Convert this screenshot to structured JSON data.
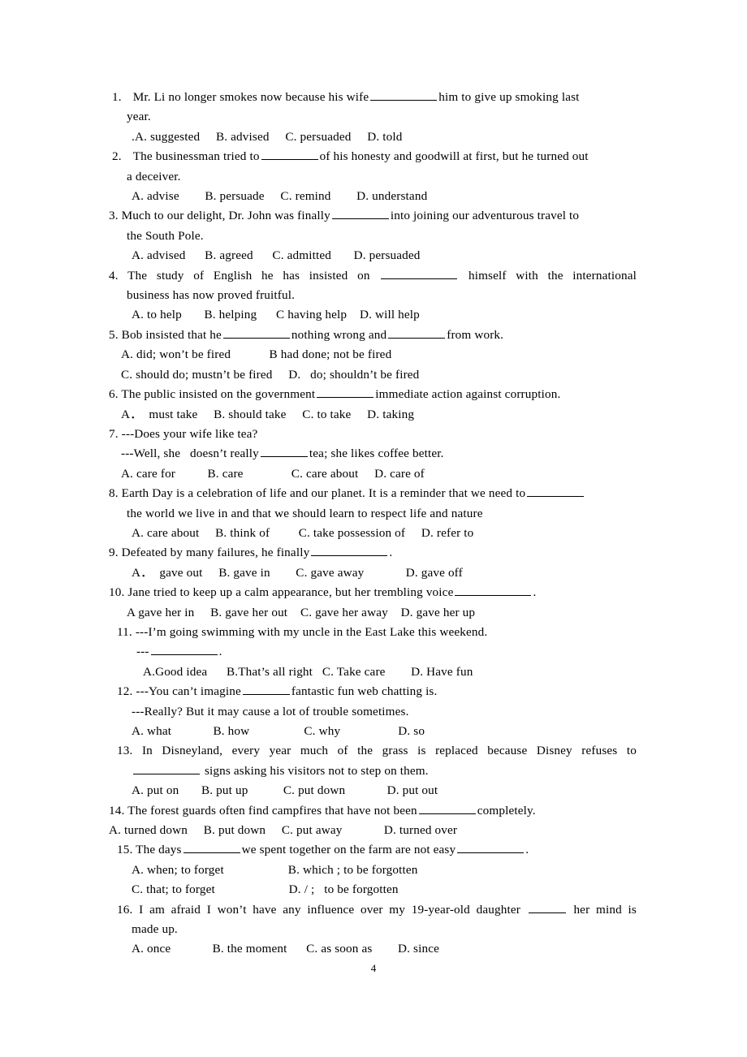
{
  "document": {
    "page_number": "4",
    "questions": [
      {
        "number": "1.",
        "stem_line_1": "Mr. Li no longer smokes now because his wife",
        "stem_line_1_tail": "him to give up smoking last",
        "stem_line_2": "year.",
        "options_line": ".A. suggested     B. advised     C. persuaded     D. told"
      },
      {
        "number": "2.",
        "stem_line_1": "The businessman tried to",
        "stem_line_1_tail": "of his honesty and goodwill at first, but he turned out",
        "stem_line_2": "a deceiver.",
        "options_line": "A. advise        B. persuade     C. remind        D. understand"
      },
      {
        "number": "3.",
        "stem_line_1": "Much to our delight, Dr. John was finally",
        "stem_line_1_tail": "into joining our adventurous travel to",
        "stem_line_2": "the South Pole.",
        "options_line": "A. advised      B. agreed      C. admitted       D. persuaded"
      },
      {
        "number": "4.",
        "stem_line_1": "The study of English he has insisted on",
        "stem_line_1_tail": "himself with the international",
        "stem_line_2": "business has now proved fruitful.",
        "options_line": "A. to help       B. helping      C having help    D. will help"
      },
      {
        "number": "5.",
        "stem_line_1a": "Bob insisted that he",
        "stem_line_1b": "nothing wrong and",
        "stem_line_1c": "from work.",
        "options_line_1": "A. did; won’t be fired            B had done; not be fired",
        "options_line_2": "C. should do; mustn’t be fired     D.   do; shouldn’t be fired"
      },
      {
        "number": "6.",
        "stem_line_1": "The public insisted on the government",
        "stem_line_1_tail": "immediate action against corruption.",
        "options_line": "A．  must take     B. should take     C. to take     D. taking"
      },
      {
        "number": "7.",
        "stem_line_1": "---Does your wife like tea?",
        "stem_line_2a": "---Well, she   doesn’t really",
        "stem_line_2b": "tea; she likes coffee better.",
        "options_line": "A. care for          B. care               C. care about     D. care of"
      },
      {
        "number": "8.",
        "stem_line_1": "Earth Day is a celebration of life and our planet. It is a reminder that we need to",
        "stem_line_2": "the world we live in and that we should learn to respect life and nature",
        "options_line": "A. care about     B. think of         C. take possession of     D. refer to"
      },
      {
        "number": "9.",
        "stem_line_1": "Defeated by many failures, he finally",
        "stem_line_1_tail": ".",
        "options_line": "A．  gave out     B. gave in        C. gave away             D. gave off"
      },
      {
        "number": "10.",
        "stem_line_1": "Jane tried to keep up a calm appearance, but her trembling voice",
        "stem_line_1_tail": ".",
        "options_line": "A gave her in     B. gave her out    C. gave her away    D. gave her up"
      },
      {
        "number": "11.",
        "stem_line_1": "---I’m going swimming with my uncle in the East Lake this weekend.",
        "stem_line_2_prefix": "---",
        "stem_line_2_suffix": ".",
        "options_line": "A.Good idea      B.That’s all right   C. Take care        D. Have fun"
      },
      {
        "number": "12.",
        "stem_line_1a": "---You can’t imagine",
        "stem_line_1b": "fantastic fun web chatting is.",
        "stem_line_2": "---Really? But it may cause a lot of trouble sometimes.",
        "options_line": "A. what             B. how                 C. why                  D. so"
      },
      {
        "number": "13.",
        "stem_line_1": "In Disneyland, every year much of the grass is replaced because Disney refuses to",
        "stem_line_2_tail": "signs asking his visitors not to step on them.",
        "options_line": "A. put on       B. put up           C. put down             D. put out"
      },
      {
        "number": "14.",
        "stem_line_1": "The forest guards often find campfires that have not been",
        "stem_line_1_tail": "completely.",
        "options_line": "A. turned down     B. put down     C. put away             D. turned over"
      },
      {
        "number": "15.",
        "stem_line_1a": "The days",
        "stem_line_1b": "we spent together on the farm are not easy",
        "stem_line_1c": ".",
        "options_line_1": "A. when; to forget                    B. which ; to be forgotten",
        "options_line_2": "C. that; to forget                       D. / ;   to be forgotten"
      },
      {
        "number": "16.",
        "stem_line_1": "I am afraid I won’t have any influence over my 19-year-old daughter",
        "stem_line_1_tail": "her mind is",
        "stem_line_2": "made up.",
        "options_line": "A. once             B. the moment      C. as soon as        D. since"
      }
    ]
  }
}
